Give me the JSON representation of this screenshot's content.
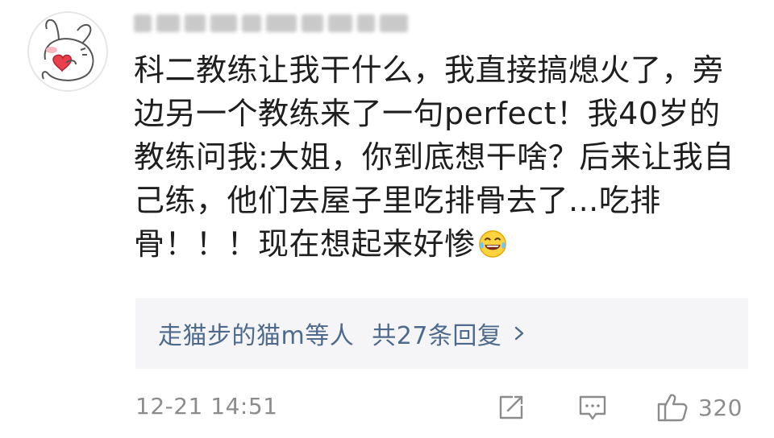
{
  "comment": {
    "avatar_icon": "cartoon-rabbit-holding-heart-icon",
    "username": "",
    "text": "科二教练让我干什么，我直接搞熄火了，旁边另一个教练来了一句perfect！我40岁的教练问我:大姐，你到底想干啥？后来让我自己练，他们去屋子里吃排骨去了...吃排骨！！！现在想起来好惨",
    "emoji": "laughing-crying-emoji",
    "replies": {
      "users_text": "走猫步的猫m等人",
      "count_text": "共27条回复",
      "chevron_icon": "chevron-right-icon"
    },
    "footer": {
      "timestamp": "12-21 14:51",
      "forward_icon": "share-edit-icon",
      "comment_icon": "comment-bubble-icon",
      "like_icon": "thumbs-up-icon",
      "like_count": "320"
    }
  },
  "colors": {
    "text": "#1e1e1e",
    "link": "#4d6a8c",
    "muted": "#8c8c8c",
    "reply_bg": "#f5f5f7"
  }
}
